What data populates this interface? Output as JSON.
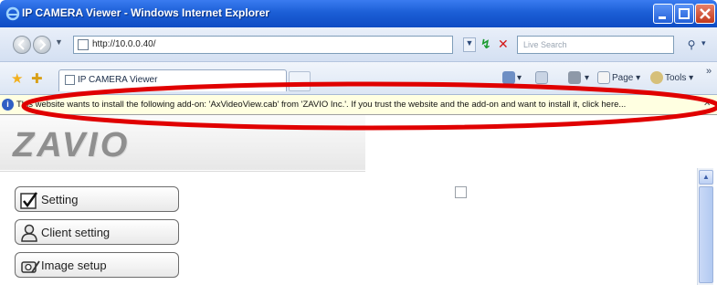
{
  "window": {
    "title": "IP CAMERA Viewer - Windows Internet Explorer"
  },
  "address_bar": {
    "url": "http://10.0.0.40/",
    "search_placeholder": "Live Search"
  },
  "tab": {
    "label": "IP CAMERA Viewer"
  },
  "commands": {
    "page_label": "Page",
    "tools_label": "Tools"
  },
  "infobar": {
    "message": "This website wants to install the following add-on: 'AxVideoView.cab' from 'ZAVIO Inc.'. If you trust the website and the add-on and want to install it, click here..."
  },
  "page": {
    "logo_text": "ZAVIO",
    "menu": [
      {
        "label": "Setting",
        "icon": "checkmark-icon"
      },
      {
        "label": "Client setting",
        "icon": "user-icon"
      },
      {
        "label": "Image setup",
        "icon": "camera-icon"
      }
    ]
  },
  "colors": {
    "titlebar": "#1c5fd6",
    "infobar": "#ffffe1",
    "annotation": "#e00000"
  }
}
